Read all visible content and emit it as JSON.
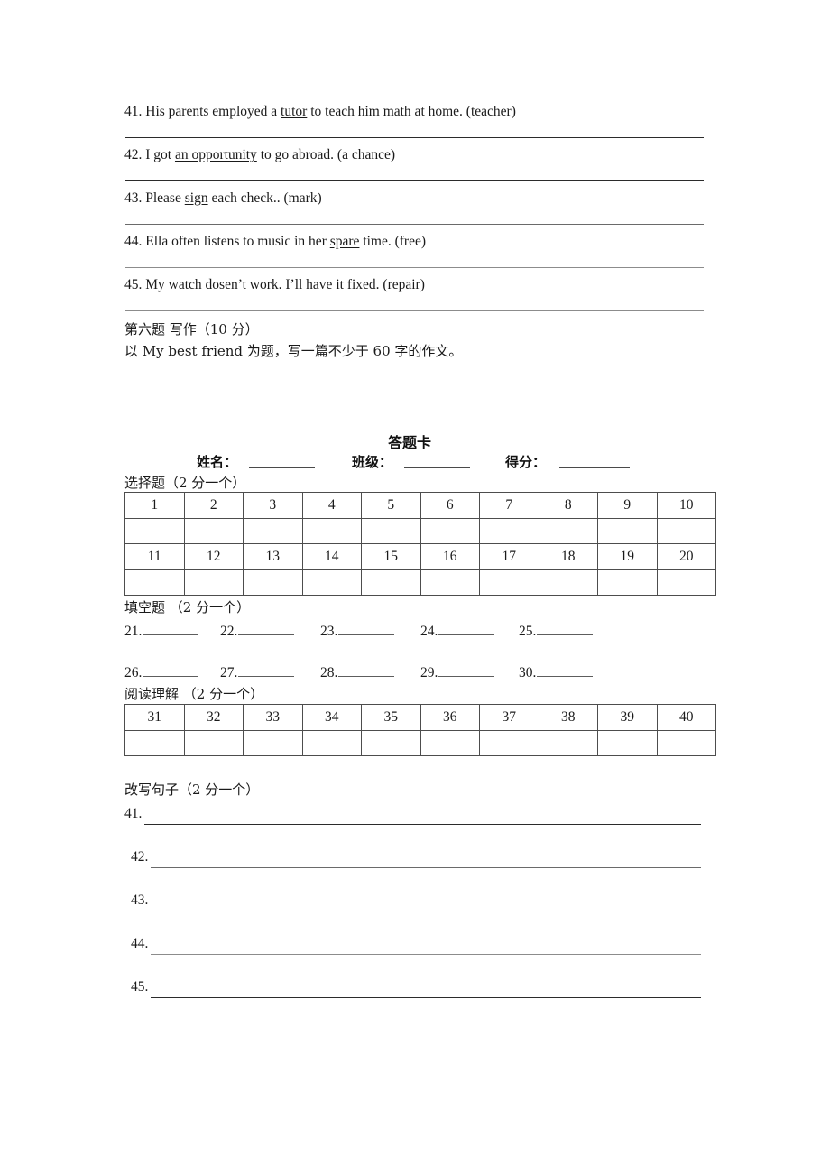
{
  "document": {
    "sheet_title": "答题卡"
  },
  "rewrite_top": {
    "items": [
      {
        "num": "41.",
        "before": " His parents employed a ",
        "underlined": "tutor",
        "after": " to teach him math at home. (teacher)"
      },
      {
        "num": "42.",
        "before": " I got ",
        "underlined": "an opportunity",
        "after": " to go abroad. (a chance)"
      },
      {
        "num": "43.",
        "before": " Please ",
        "underlined": "sign",
        "after": " each check.. (mark)"
      },
      {
        "num": "44.",
        "before": " Ella often listens to music in her ",
        "underlined": "spare",
        "after": " time. (free)"
      },
      {
        "num": "45.",
        "before": " My watch dosen’t work. I’ll have it ",
        "underlined": "fixed",
        "after": ". (repair)"
      }
    ]
  },
  "writing_section": {
    "heading": "第六题 写作（10 分）",
    "prompt": "以 My best friend 为题，写一篇不少于 60 字的作文。"
  },
  "answer_card": {
    "title": "答题卡",
    "fields": [
      {
        "label": "姓名："
      },
      {
        "label": "班级："
      },
      {
        "label": "得分："
      }
    ],
    "choice_section": {
      "heading": "选择题（2 分一个）",
      "row1": [
        "1",
        "2",
        "3",
        "4",
        "5",
        "6",
        "7",
        "8",
        "9",
        "10"
      ],
      "row1_answers": [
        "",
        "",
        "",
        "",
        "",
        "",
        "",
        "",
        "",
        ""
      ],
      "row2": [
        "11",
        "12",
        "13",
        "14",
        "15",
        "16",
        "17",
        "18",
        "19",
        "20"
      ],
      "row2_answers": [
        "",
        "",
        "",
        "",
        "",
        "",
        "",
        "",
        "",
        ""
      ]
    },
    "blank_section": {
      "heading": "填空题 （2 分一个）",
      "row1": [
        "21.",
        "22.",
        "23.",
        "24.",
        "25."
      ],
      "row2": [
        "26.",
        "27.",
        "28.",
        "29.",
        "30."
      ]
    },
    "reading_section": {
      "heading": "阅读理解 （2 分一个）",
      "row1": [
        "31",
        "32",
        "33",
        "34",
        "35",
        "36",
        "37",
        "38",
        "39",
        "40"
      ],
      "row1_answers": [
        "",
        "",
        "",
        "",
        "",
        "",
        "",
        "",
        "",
        ""
      ]
    },
    "rewrite_section": {
      "heading": "改写句子（2 分一个）",
      "items": [
        "41.",
        "42.",
        "43.",
        "44.",
        "45."
      ]
    }
  }
}
